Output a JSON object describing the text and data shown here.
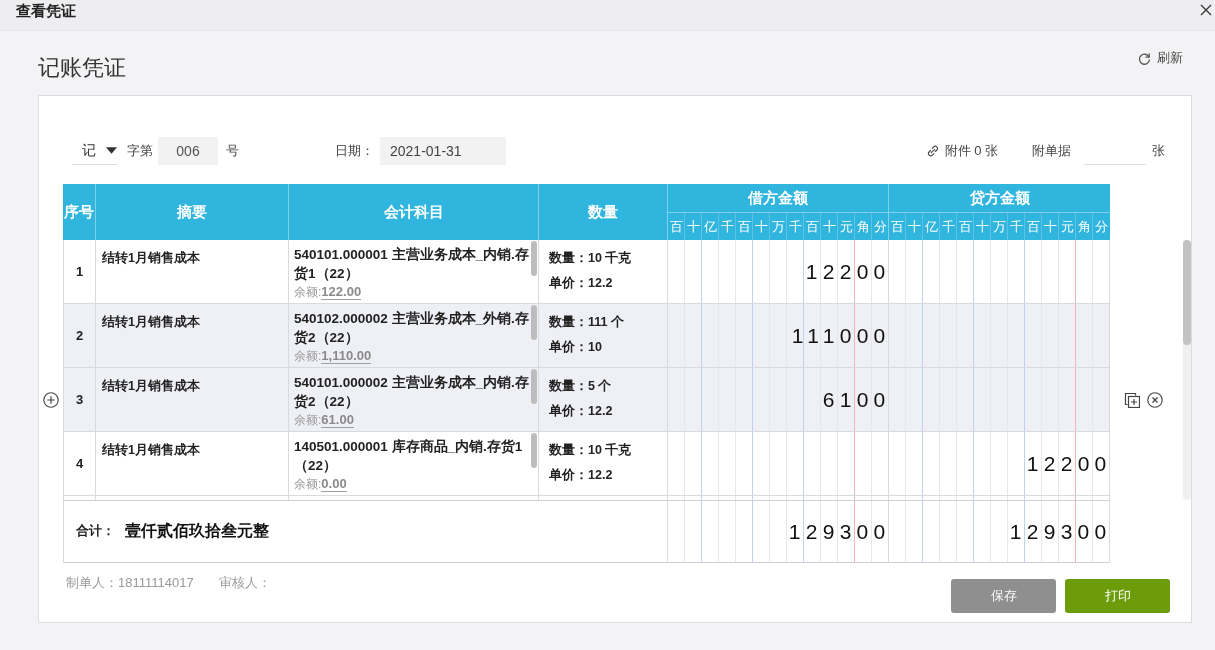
{
  "window": {
    "title": "查看凭证"
  },
  "heading": {
    "title": "记账凭证",
    "refresh": "刷新"
  },
  "form": {
    "voucher_type": "记",
    "number_prefix": "字第",
    "number": "006",
    "number_suffix": "号",
    "date_label": "日期：",
    "date": "2021-01-31",
    "attachments": "附件 0 张",
    "documents_label": "附单据",
    "documents_unit": "张"
  },
  "table": {
    "columns": [
      "序号",
      "摘要",
      "会计科目",
      "数量"
    ],
    "debit": {
      "label": "借方金额",
      "units": [
        "百",
        "十",
        "亿",
        "千",
        "百",
        "十",
        "万",
        "千",
        "百",
        "十",
        "元",
        "角",
        "分"
      ]
    },
    "credit": {
      "label": "贷方金额",
      "units": [
        "百",
        "十",
        "亿",
        "千",
        "百",
        "十",
        "万",
        "千",
        "百",
        "十",
        "元",
        "角",
        "分"
      ]
    },
    "rows": [
      {
        "number": "1",
        "summary": "结转1月销售成本",
        "account": "540101.000001 主营业务成本_内销.存货1（22）",
        "balance_label": "余额:",
        "balance": "122.00",
        "quantity": "数量：10 千克",
        "price": "单价：12.2",
        "debit": "12200",
        "shaded": false,
        "hovered": false
      },
      {
        "number": "2",
        "summary": "结转1月销售成本",
        "account": "540102.000002 主营业务成本_外销.存货2（22）",
        "balance_label": "余额:",
        "balance": "1,110.00",
        "quantity": "数量：111 个",
        "price": "单价：10",
        "debit": "111000",
        "shaded": true,
        "hovered": false
      },
      {
        "number": "3",
        "summary": "结转1月销售成本",
        "account": "540101.000002 主营业务成本_内销.存货2（22）",
        "balance_label": "余额:",
        "balance": "61.00",
        "quantity": "数量：5 个",
        "price": "单价：12.2",
        "debit": "6100",
        "shaded": true,
        "hovered": true
      },
      {
        "number": "4",
        "summary": "结转1月销售成本",
        "account": "140501.000001 库存商品_内销.存货1（22）",
        "balance_label": "余额:",
        "balance": "0.00",
        "quantity": "数量：10 千克",
        "price": "单价：12.2",
        "credit": "12200",
        "shaded": false,
        "hovered": false
      }
    ],
    "total": {
      "label": "合计：",
      "amount_in_words": "壹仟贰佰玖拾叁元整",
      "debit": "129300",
      "credit": "129300"
    }
  },
  "footer": {
    "maker": "制单人：18111114017",
    "reviewer": "审核人："
  },
  "buttons": [
    {
      "label": "保存",
      "disabled": true
    },
    {
      "label": "打印",
      "disabled": false
    }
  ]
}
